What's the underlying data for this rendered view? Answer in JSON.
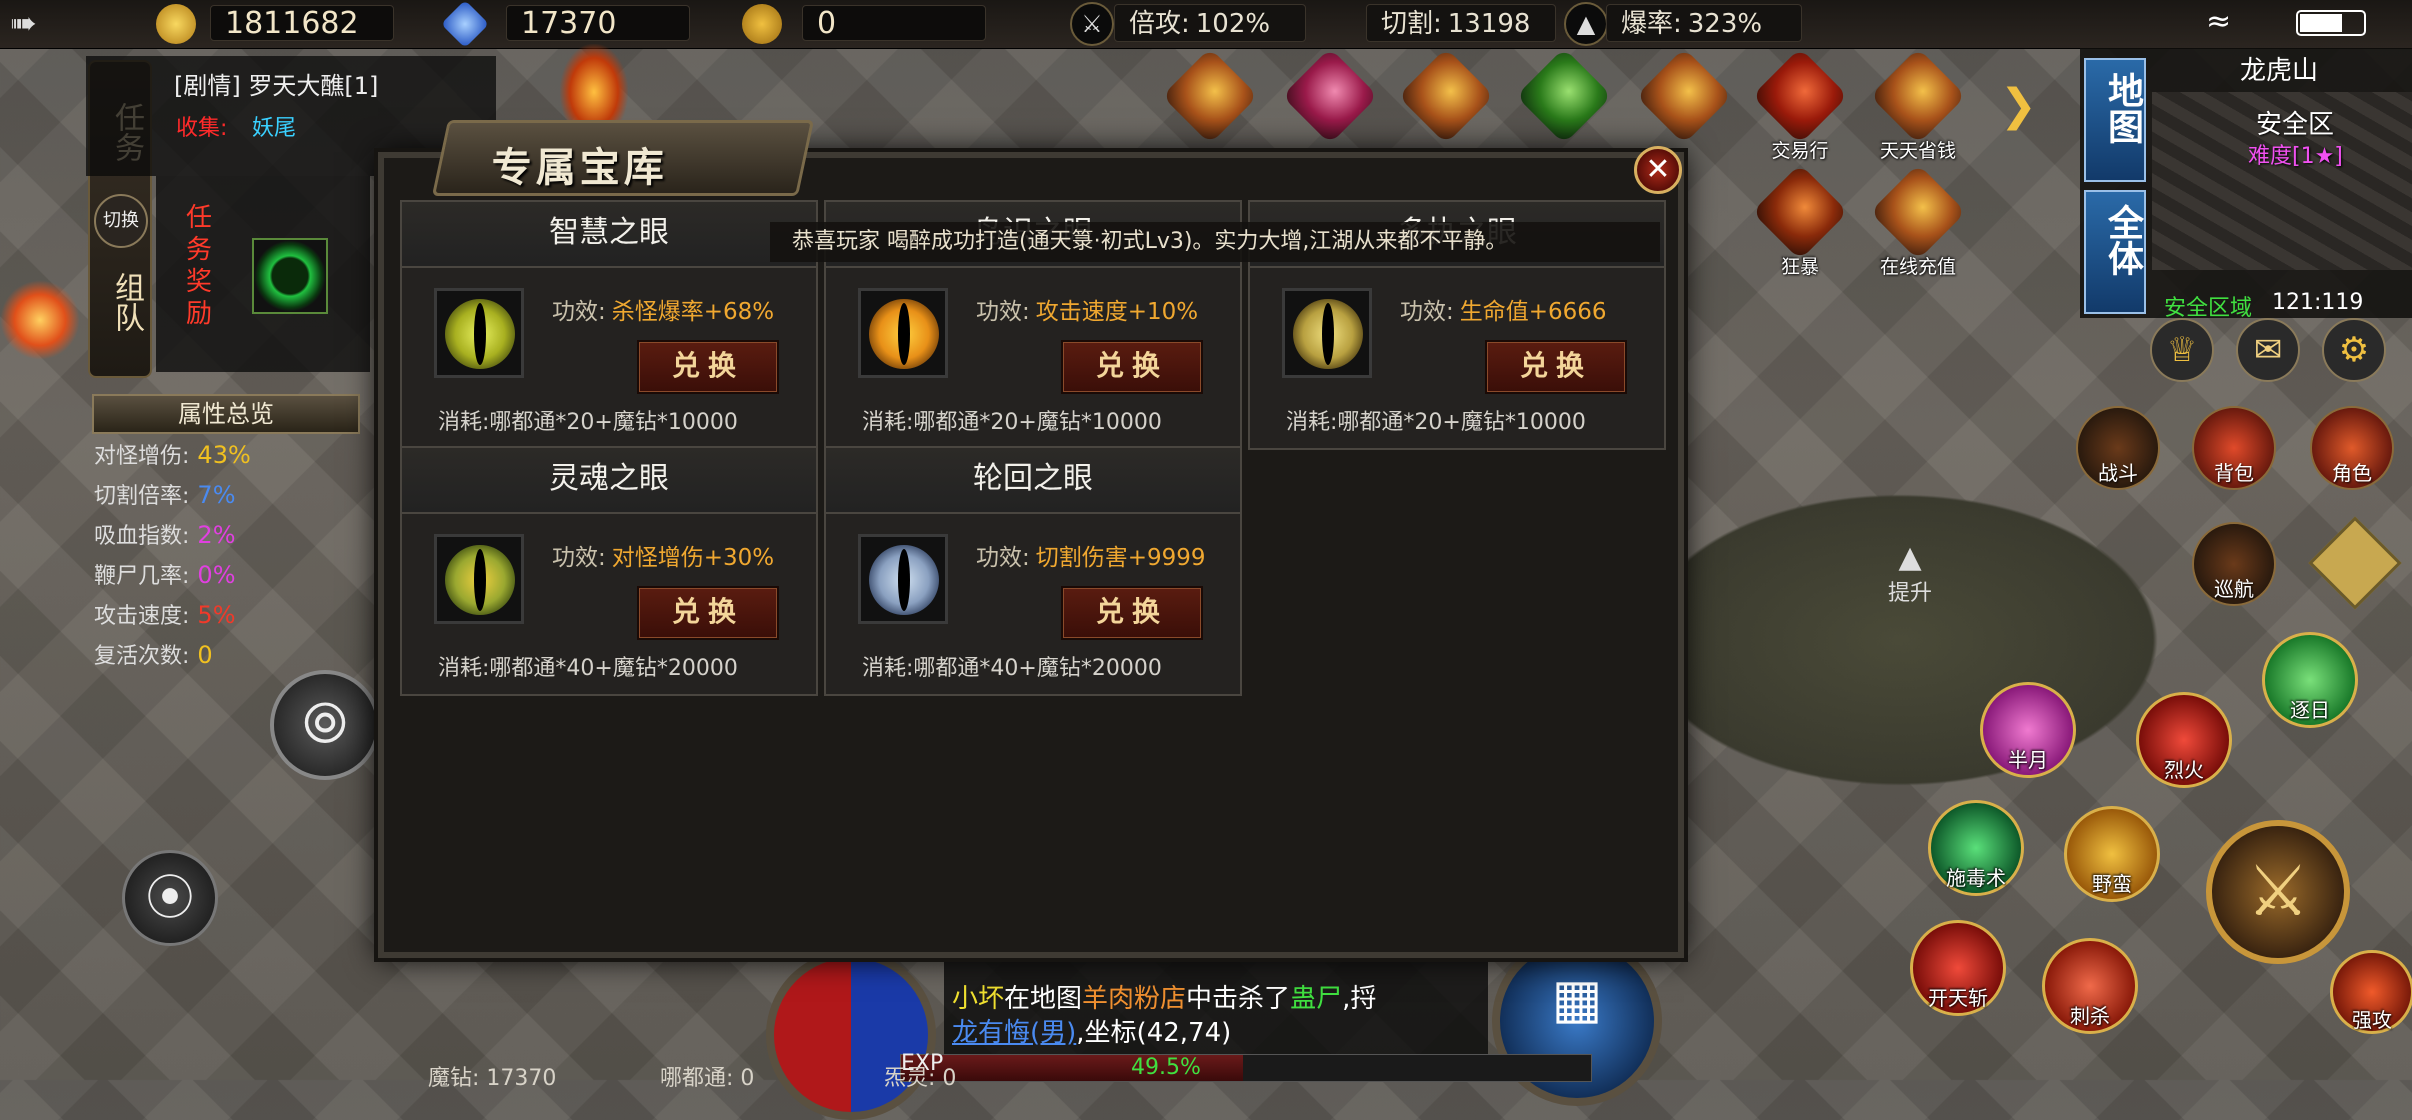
{
  "topbar": {
    "gold": "1811682",
    "diamond": "17370",
    "coin": "0",
    "multiplier_label": "倍攻:",
    "multiplier_value": "102%",
    "cut_label": "切割:",
    "cut_value": "13198",
    "crit_label": "爆率:",
    "crit_value": "323%"
  },
  "minimap": {
    "map_name": "龙虎山",
    "zone": "安全区",
    "difficulty": "难度[1★]",
    "area": "安全区域",
    "coords": "121:119",
    "btn_map": "地图",
    "btn_all": "全体"
  },
  "quest": {
    "title": "[剧情] 罗天大醮[1]",
    "collect_label": "收集:",
    "collect_value": "妖尾",
    "tab_task": "任务",
    "tab_switch": "切换",
    "tab_team": "组队",
    "reward": "任务奖励"
  },
  "attributes": {
    "title": "属性总览",
    "rows": [
      {
        "label": "对怪增伤:",
        "value": "43%",
        "color": "#f0c020"
      },
      {
        "label": "切割倍率:",
        "value": "7%",
        "color": "#4a8af0"
      },
      {
        "label": "吸血指数:",
        "value": "2%",
        "color": "#e040e0"
      },
      {
        "label": "鞭尸几率:",
        "value": "0%",
        "color": "#e040e0"
      },
      {
        "label": "攻击速度:",
        "value": "5%",
        "color": "#f03a2a"
      },
      {
        "label": "复活次数:",
        "value": "0",
        "color": "#f0c020"
      }
    ]
  },
  "top_icons": [
    "交易行",
    "天天省钱",
    "狂暴",
    "在线充值"
  ],
  "panel": {
    "title": "专属宝库",
    "ticker": "恭喜玩家 喝醉成功打造(通天箓·初式Lv3)。实力大增,江湖从来都不平静。",
    "cards": [
      {
        "name": "智慧之眼",
        "effect_label": "功效:",
        "effect": "杀怪爆率+68%",
        "button": "兑换",
        "cost": "消耗:哪都通*20+魔钻*10000",
        "eye": "#a8b020"
      },
      {
        "name": "鸟识之眼",
        "effect_label": "功效:",
        "effect": "攻击速度+10%",
        "button": "兑换",
        "cost": "消耗:哪都通*20+魔钻*10000",
        "eye": "#e89018"
      },
      {
        "name": "多执之眼",
        "effect_label": "功效:",
        "effect": "生命值+6666",
        "button": "兑换",
        "cost": "消耗:哪都通*20+魔钻*10000",
        "eye": "#b8a040"
      },
      {
        "name": "灵魂之眼",
        "effect_label": "功效:",
        "effect": "对怪增伤+30%",
        "button": "兑换",
        "cost": "消耗:哪都通*40+魔钻*20000",
        "eye": "#9aa830"
      },
      {
        "name": "轮回之眼",
        "effect_label": "功效:",
        "effect": "切割伤害+9999",
        "button": "兑换",
        "cost": "消耗:哪都通*40+魔钻*20000",
        "eye": "#8aa0c0"
      }
    ],
    "footer": {
      "diamond": "魔钻: 17370",
      "nadutong": "哪都通: 0",
      "shouling": "炁灵: 0"
    }
  },
  "side_icons": [
    "战斗",
    "背包",
    "角色",
    "巡航",
    "提升"
  ],
  "skills": [
    "逐日",
    "半月",
    "烈火",
    "施毒术",
    "野蛮",
    "开天斩",
    "刺杀",
    "强攻"
  ],
  "chat": {
    "line1_name": "小坏",
    "line1_mid": "在地图",
    "line1_place": "羊肉粉店",
    "line1_mid2": "中击杀了",
    "line1_target": "蛊尸",
    "line1_tail": ",捋",
    "line2_name": "龙有悔(男)",
    "line2_tail": ",坐标(42,74)"
  },
  "exp": {
    "label": "EXP",
    "value": "49.5%",
    "fraction": 0.495
  }
}
